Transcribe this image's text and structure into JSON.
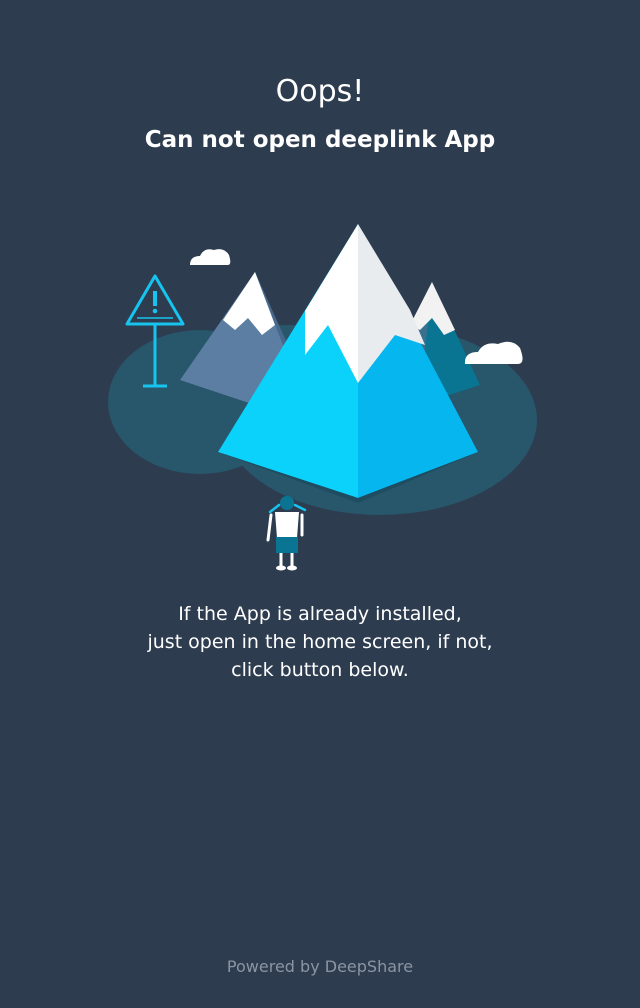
{
  "header": {
    "title": "Oops!",
    "subtitle": "Can not open deeplink App"
  },
  "message": {
    "lines": [
      "If the App is already installed,",
      "just open in the home screen, if not,",
      "click button below."
    ]
  },
  "footer": {
    "powered_by": "Powered by DeepShare"
  },
  "colors": {
    "background": "#2d3c4f",
    "accent": "#0fc8f5",
    "footer_text": "#8b95a3"
  },
  "illustration": {
    "icons": [
      "warning-sign-icon",
      "cloud-icon",
      "mountain-icon",
      "hiker-icon"
    ]
  }
}
